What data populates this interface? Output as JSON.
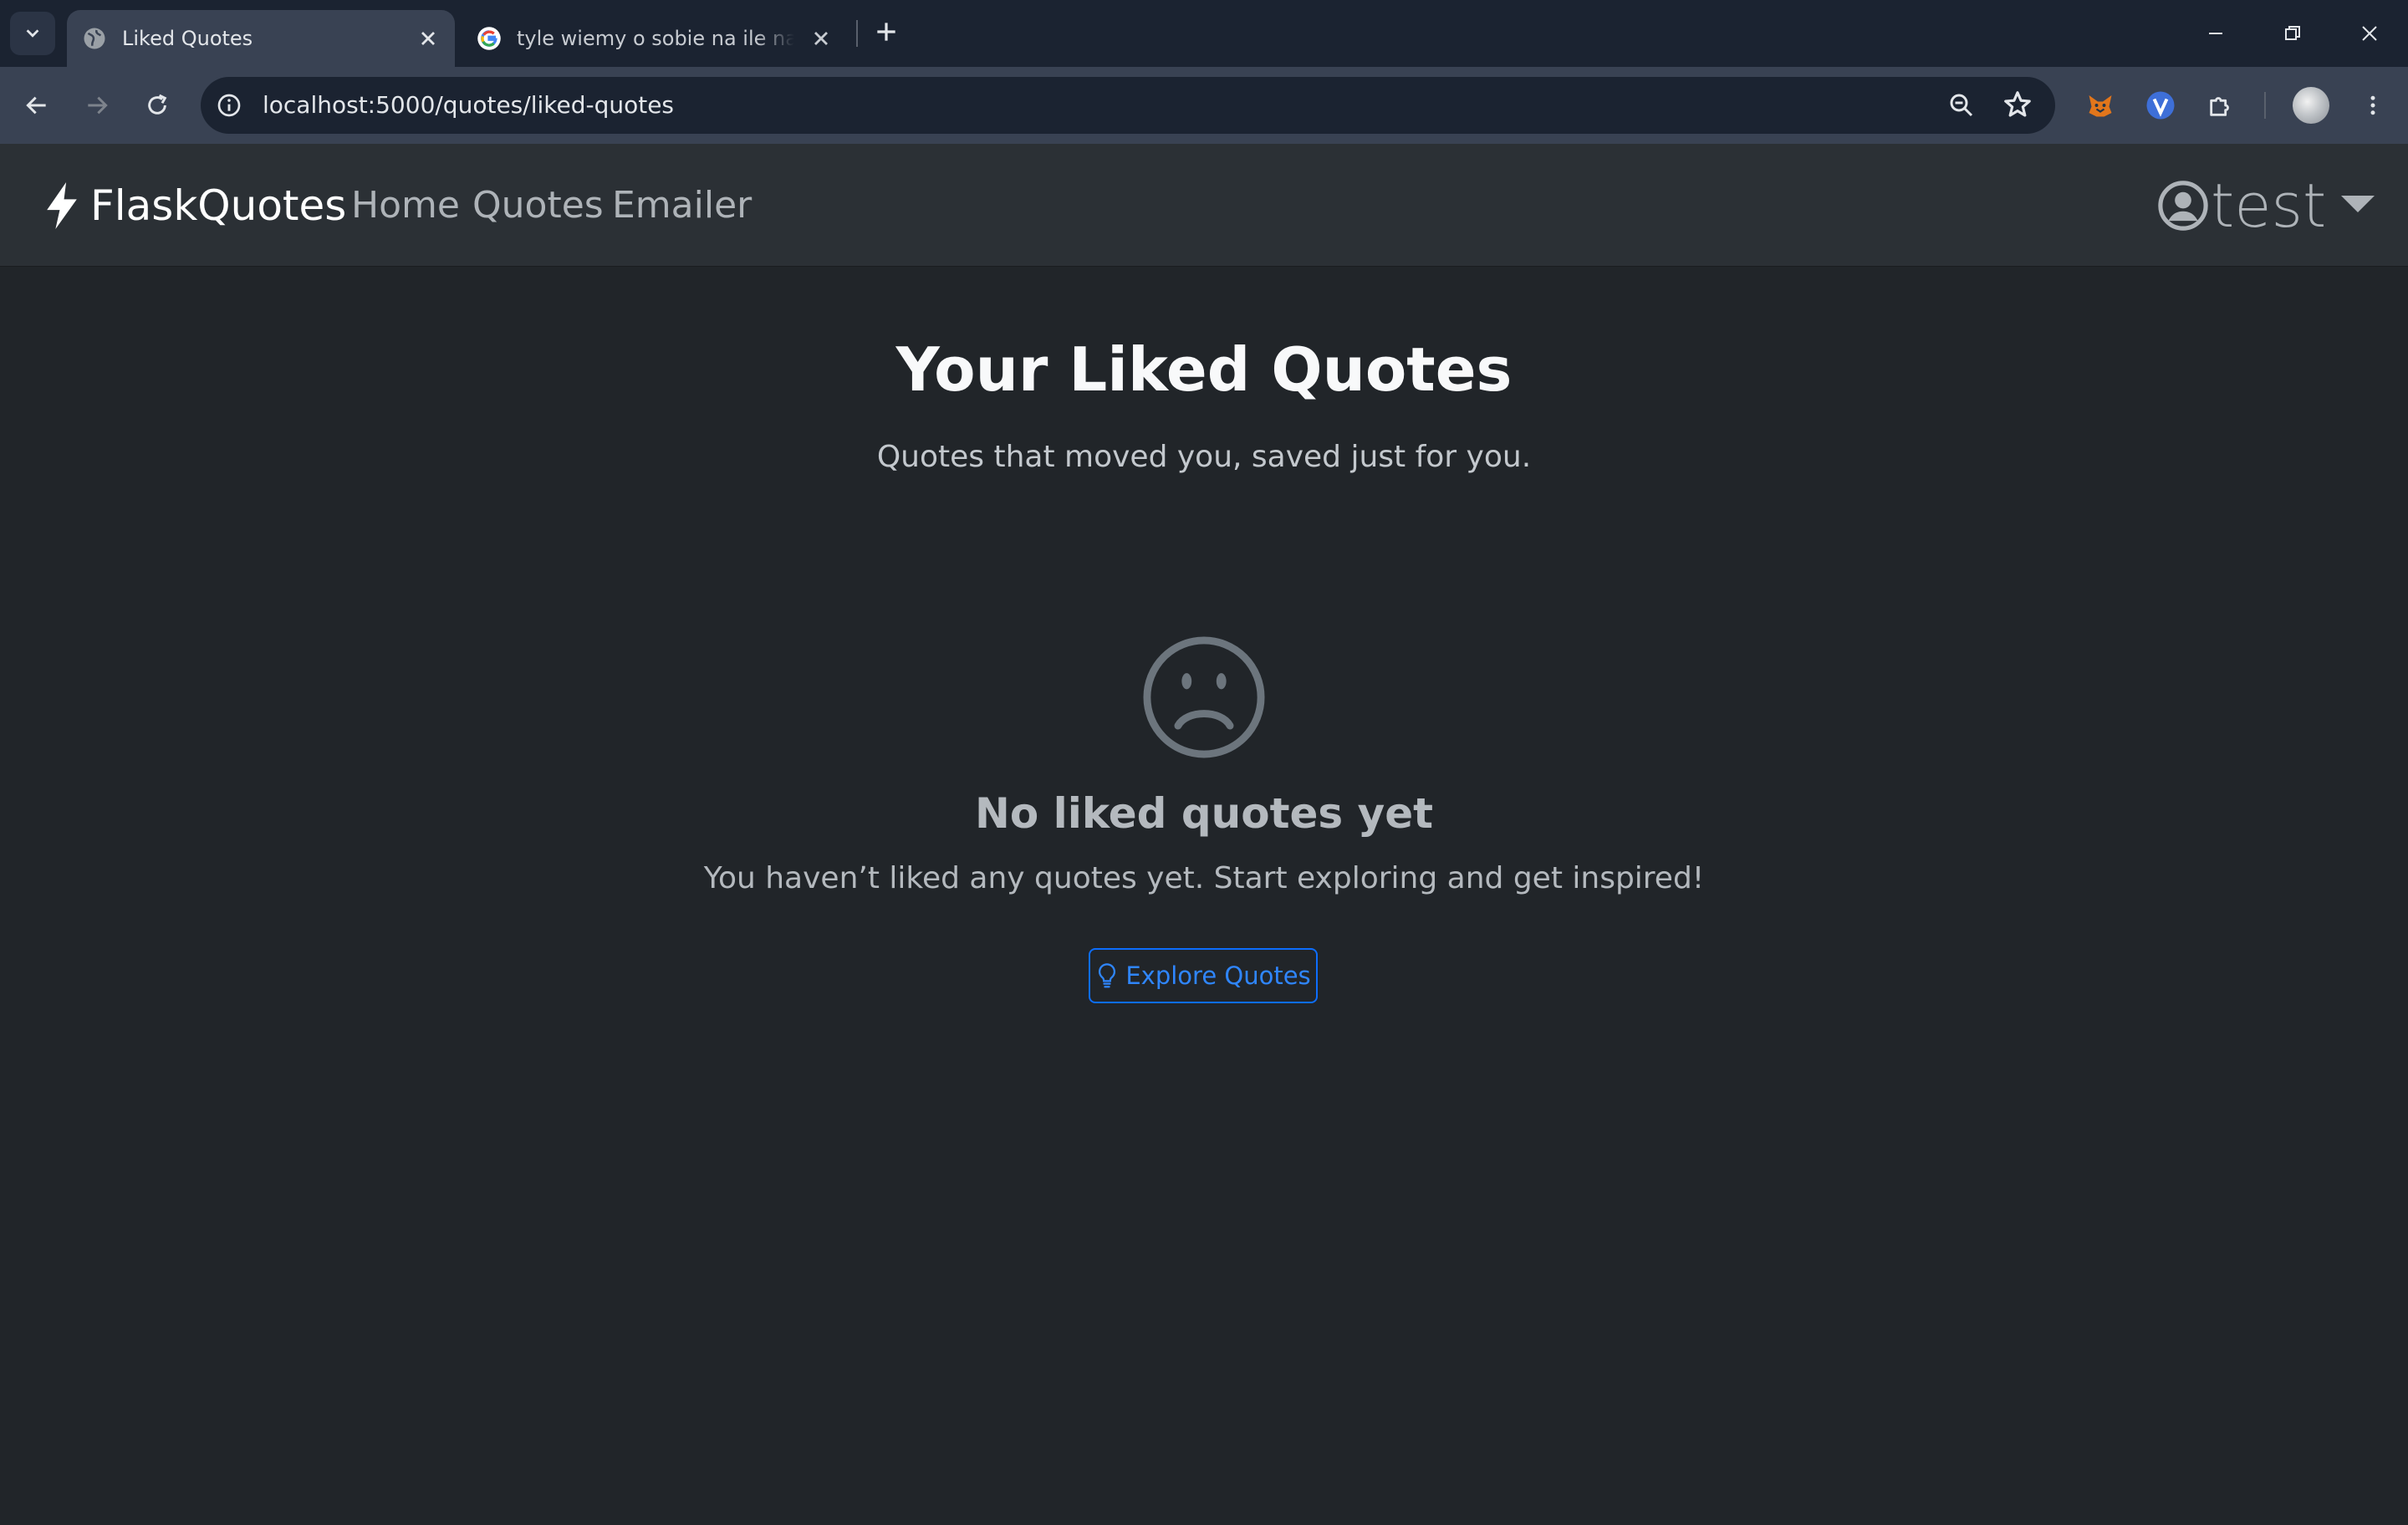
{
  "browser": {
    "tabs": [
      {
        "title": "Liked Quotes",
        "active": true,
        "favicon": "globe-icon"
      },
      {
        "title": "tyle wiemy o sobie na ile nas sprawdzono",
        "active": false,
        "favicon": "google-icon"
      }
    ],
    "address_bar": {
      "url": "localhost:5000/quotes/liked-quotes"
    }
  },
  "navbar": {
    "brand": "FlaskQuotes",
    "links": [
      "Home",
      "Quotes",
      "Emailer"
    ],
    "user": "test"
  },
  "main": {
    "title": "Your Liked Quotes",
    "subtitle": "Quotes that moved you, saved just for you.",
    "empty_state": {
      "icon": "sad-face-icon",
      "title": "No liked quotes yet",
      "text": "You haven’t liked any quotes yet. Start exploring and get inspired!",
      "button_label": "Explore Quotes"
    }
  },
  "colors": {
    "page_bg": "#212529",
    "navbar_bg": "#2b3035",
    "primary": "#0d6efd"
  }
}
